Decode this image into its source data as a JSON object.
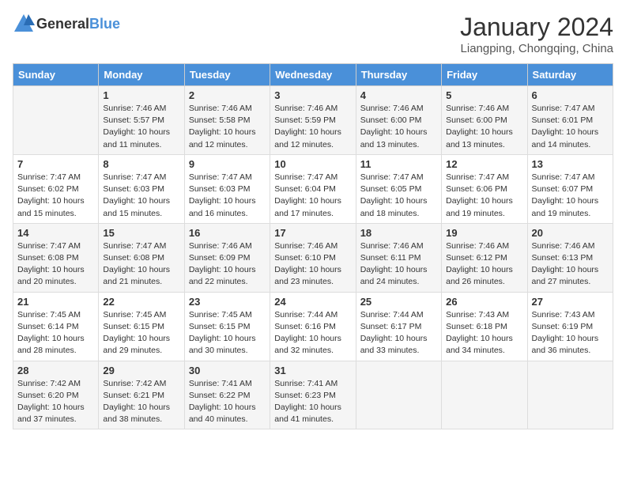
{
  "header": {
    "logo_general": "General",
    "logo_blue": "Blue",
    "month": "January 2024",
    "location": "Liangping, Chongqing, China"
  },
  "days_of_week": [
    "Sunday",
    "Monday",
    "Tuesday",
    "Wednesday",
    "Thursday",
    "Friday",
    "Saturday"
  ],
  "weeks": [
    [
      {
        "day": "",
        "info": ""
      },
      {
        "day": "1",
        "info": "Sunrise: 7:46 AM\nSunset: 5:57 PM\nDaylight: 10 hours\nand 11 minutes."
      },
      {
        "day": "2",
        "info": "Sunrise: 7:46 AM\nSunset: 5:58 PM\nDaylight: 10 hours\nand 12 minutes."
      },
      {
        "day": "3",
        "info": "Sunrise: 7:46 AM\nSunset: 5:59 PM\nDaylight: 10 hours\nand 12 minutes."
      },
      {
        "day": "4",
        "info": "Sunrise: 7:46 AM\nSunset: 6:00 PM\nDaylight: 10 hours\nand 13 minutes."
      },
      {
        "day": "5",
        "info": "Sunrise: 7:46 AM\nSunset: 6:00 PM\nDaylight: 10 hours\nand 13 minutes."
      },
      {
        "day": "6",
        "info": "Sunrise: 7:47 AM\nSunset: 6:01 PM\nDaylight: 10 hours\nand 14 minutes."
      }
    ],
    [
      {
        "day": "7",
        "info": "Sunrise: 7:47 AM\nSunset: 6:02 PM\nDaylight: 10 hours\nand 15 minutes."
      },
      {
        "day": "8",
        "info": "Sunrise: 7:47 AM\nSunset: 6:03 PM\nDaylight: 10 hours\nand 15 minutes."
      },
      {
        "day": "9",
        "info": "Sunrise: 7:47 AM\nSunset: 6:03 PM\nDaylight: 10 hours\nand 16 minutes."
      },
      {
        "day": "10",
        "info": "Sunrise: 7:47 AM\nSunset: 6:04 PM\nDaylight: 10 hours\nand 17 minutes."
      },
      {
        "day": "11",
        "info": "Sunrise: 7:47 AM\nSunset: 6:05 PM\nDaylight: 10 hours\nand 18 minutes."
      },
      {
        "day": "12",
        "info": "Sunrise: 7:47 AM\nSunset: 6:06 PM\nDaylight: 10 hours\nand 19 minutes."
      },
      {
        "day": "13",
        "info": "Sunrise: 7:47 AM\nSunset: 6:07 PM\nDaylight: 10 hours\nand 19 minutes."
      }
    ],
    [
      {
        "day": "14",
        "info": "Sunrise: 7:47 AM\nSunset: 6:08 PM\nDaylight: 10 hours\nand 20 minutes."
      },
      {
        "day": "15",
        "info": "Sunrise: 7:47 AM\nSunset: 6:08 PM\nDaylight: 10 hours\nand 21 minutes."
      },
      {
        "day": "16",
        "info": "Sunrise: 7:46 AM\nSunset: 6:09 PM\nDaylight: 10 hours\nand 22 minutes."
      },
      {
        "day": "17",
        "info": "Sunrise: 7:46 AM\nSunset: 6:10 PM\nDaylight: 10 hours\nand 23 minutes."
      },
      {
        "day": "18",
        "info": "Sunrise: 7:46 AM\nSunset: 6:11 PM\nDaylight: 10 hours\nand 24 minutes."
      },
      {
        "day": "19",
        "info": "Sunrise: 7:46 AM\nSunset: 6:12 PM\nDaylight: 10 hours\nand 26 minutes."
      },
      {
        "day": "20",
        "info": "Sunrise: 7:46 AM\nSunset: 6:13 PM\nDaylight: 10 hours\nand 27 minutes."
      }
    ],
    [
      {
        "day": "21",
        "info": "Sunrise: 7:45 AM\nSunset: 6:14 PM\nDaylight: 10 hours\nand 28 minutes."
      },
      {
        "day": "22",
        "info": "Sunrise: 7:45 AM\nSunset: 6:15 PM\nDaylight: 10 hours\nand 29 minutes."
      },
      {
        "day": "23",
        "info": "Sunrise: 7:45 AM\nSunset: 6:15 PM\nDaylight: 10 hours\nand 30 minutes."
      },
      {
        "day": "24",
        "info": "Sunrise: 7:44 AM\nSunset: 6:16 PM\nDaylight: 10 hours\nand 32 minutes."
      },
      {
        "day": "25",
        "info": "Sunrise: 7:44 AM\nSunset: 6:17 PM\nDaylight: 10 hours\nand 33 minutes."
      },
      {
        "day": "26",
        "info": "Sunrise: 7:43 AM\nSunset: 6:18 PM\nDaylight: 10 hours\nand 34 minutes."
      },
      {
        "day": "27",
        "info": "Sunrise: 7:43 AM\nSunset: 6:19 PM\nDaylight: 10 hours\nand 36 minutes."
      }
    ],
    [
      {
        "day": "28",
        "info": "Sunrise: 7:42 AM\nSunset: 6:20 PM\nDaylight: 10 hours\nand 37 minutes."
      },
      {
        "day": "29",
        "info": "Sunrise: 7:42 AM\nSunset: 6:21 PM\nDaylight: 10 hours\nand 38 minutes."
      },
      {
        "day": "30",
        "info": "Sunrise: 7:41 AM\nSunset: 6:22 PM\nDaylight: 10 hours\nand 40 minutes."
      },
      {
        "day": "31",
        "info": "Sunrise: 7:41 AM\nSunset: 6:23 PM\nDaylight: 10 hours\nand 41 minutes."
      },
      {
        "day": "",
        "info": ""
      },
      {
        "day": "",
        "info": ""
      },
      {
        "day": "",
        "info": ""
      }
    ]
  ]
}
